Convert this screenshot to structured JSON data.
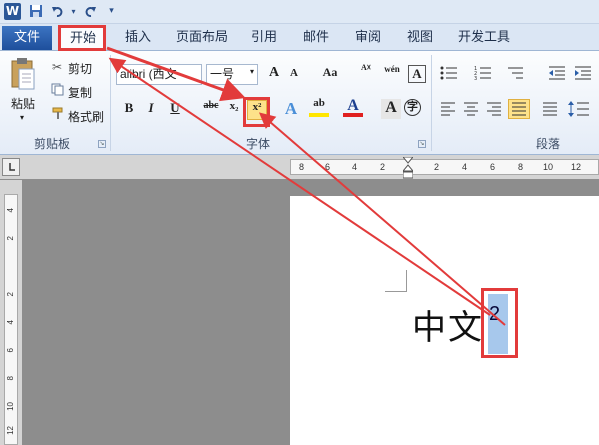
{
  "quick_access": {
    "logo": "W",
    "save_icon": "save-icon",
    "undo_icon": "undo-icon",
    "redo_icon": "redo-icon",
    "customize_icon": "customize-icon"
  },
  "tabs": [
    {
      "label": "文件"
    },
    {
      "label": "开始"
    },
    {
      "label": "插入"
    },
    {
      "label": "页面布局"
    },
    {
      "label": "引用"
    },
    {
      "label": "邮件"
    },
    {
      "label": "审阅"
    },
    {
      "label": "视图"
    },
    {
      "label": "开发工具"
    }
  ],
  "clipboard": {
    "paste": "粘贴",
    "cut": "剪切",
    "copy": "复制",
    "format_painter": "格式刷",
    "group": "剪贴板"
  },
  "font": {
    "name": "alibri (西文",
    "size": "一号",
    "bold": "B",
    "italic": "I",
    "underline": "U",
    "strike": "abc",
    "subscript": "x₂",
    "superscript": "x²",
    "text_effect": "A",
    "highlight": "ab",
    "font_color": "A",
    "char_shading": "A",
    "enclose": "字",
    "grow": "A",
    "shrink": "A",
    "change_case": "Aa",
    "phonetic": "wén",
    "border": "A",
    "group": "字体"
  },
  "paragraph": {
    "group": "段落"
  },
  "ruler_h_numbers": [
    "8",
    "6",
    "4",
    "2",
    "2",
    "4",
    "6",
    "8",
    "10",
    "12"
  ],
  "ruler_v_numbers": [
    "4",
    "2",
    "2",
    "4",
    "6",
    "8",
    "10",
    "12"
  ],
  "document": {
    "text": "中文",
    "superscript": "2"
  },
  "colors": {
    "annotation": "#e23b3b",
    "file_tab": "#2b5797",
    "highlight": "#a7c8ec"
  }
}
